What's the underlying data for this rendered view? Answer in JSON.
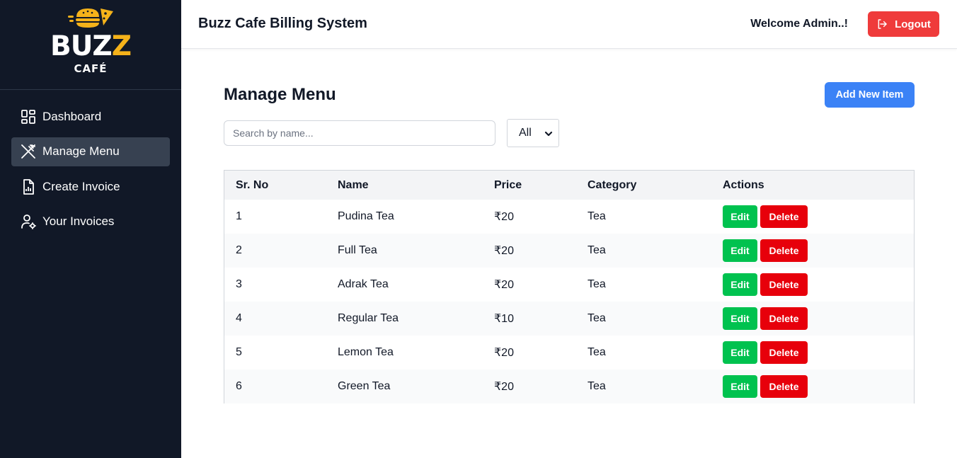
{
  "brand": {
    "name_main": "BUZ",
    "name_accent": "Z",
    "name_sub": "CAFÉ",
    "accent_color": "#f5b21a"
  },
  "sidebar": {
    "items": [
      {
        "label": "Dashboard",
        "icon": "dashboard-icon",
        "active": false
      },
      {
        "label": "Manage Menu",
        "icon": "utensils-icon",
        "active": true
      },
      {
        "label": "Create Invoice",
        "icon": "invoice-icon",
        "active": false
      },
      {
        "label": "Your Invoices",
        "icon": "user-gear-icon",
        "active": false
      }
    ]
  },
  "header": {
    "title": "Buzz Cafe Billing System",
    "welcome": "Welcome Admin..!",
    "logout_label": "Logout"
  },
  "main": {
    "title": "Manage Menu",
    "add_button": "Add New Item",
    "search_placeholder": "Search by name...",
    "filter_selected": "All"
  },
  "table": {
    "headers": [
      "Sr. No",
      "Name",
      "Price",
      "Category",
      "Actions"
    ],
    "rows": [
      {
        "sr": "1",
        "name": "Pudina Tea",
        "price": "₹20",
        "category": "Tea"
      },
      {
        "sr": "2",
        "name": "Full Tea",
        "price": "₹20",
        "category": "Tea"
      },
      {
        "sr": "3",
        "name": "Adrak Tea",
        "price": "₹20",
        "category": "Tea"
      },
      {
        "sr": "4",
        "name": "Regular Tea",
        "price": "₹10",
        "category": "Tea"
      },
      {
        "sr": "5",
        "name": "Lemon Tea",
        "price": "₹20",
        "category": "Tea"
      },
      {
        "sr": "6",
        "name": "Green Tea",
        "price": "₹20",
        "category": "Tea"
      }
    ],
    "edit_label": "Edit",
    "delete_label": "Delete"
  },
  "colors": {
    "sidebar_bg": "#111827",
    "logout": "#ef3b3b",
    "add": "#3b82f6",
    "edit": "#00c24f",
    "delete": "#e7000b"
  }
}
